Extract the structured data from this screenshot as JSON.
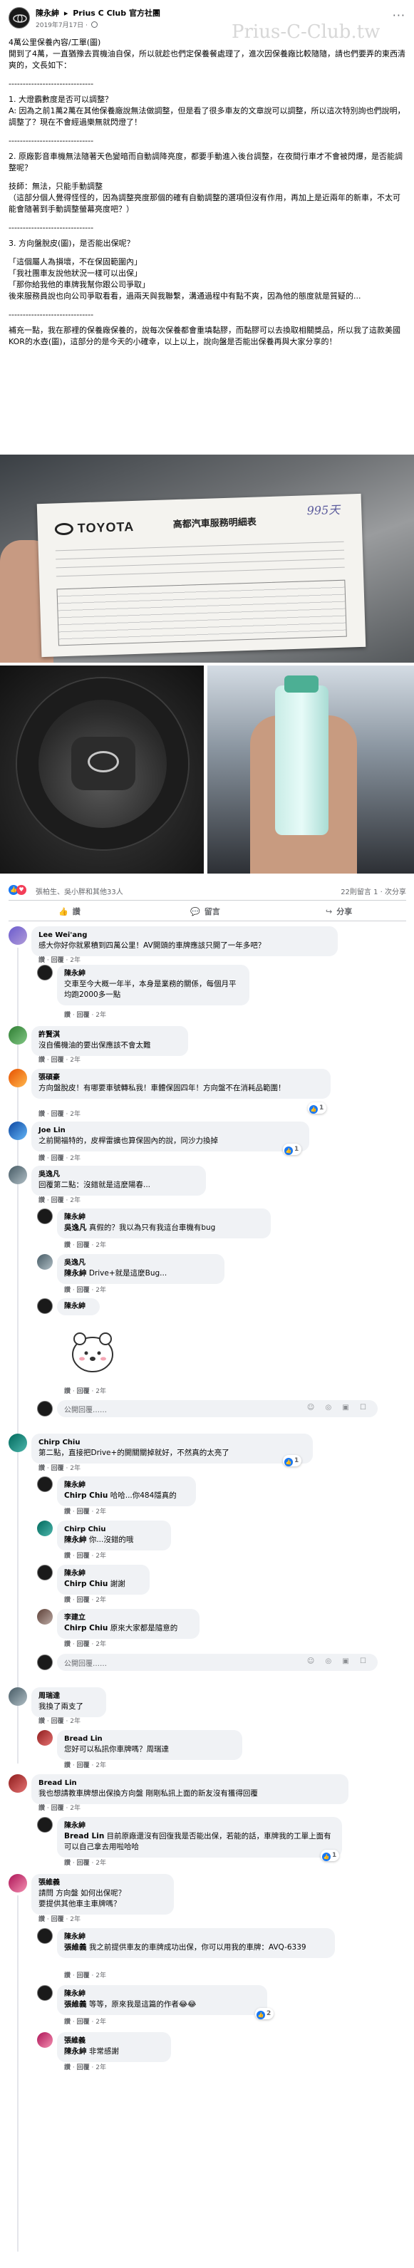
{
  "post": {
    "author": "陳永紳",
    "group": "Prius C Club 官方社團",
    "date": "2019年7月17日 ·",
    "more": "···",
    "watermark": "Prius-C-Club.tw",
    "body": [
      "4萬公里保養內容/工單(圖)",
      "開到了4萬，一直猶豫去買機油自保，所以就趁也們定保養餐處理了，進次因保養廠比較隨隨，請也們要弄的東西清爽的，文長如下：",
      "------------------------------",
      "1. 大燈霸數度是否可以調整？",
      "A: 因為之前1萬2萬在其他保養廠說無法做調整，但是看了很多車友的文章說可以調整，所以這次特別詢也們說明，調整了？現在不會經過樂無就閃燈了！",
      "------------------------------",
      "2. 原廠影音車機無法隨著天色變暗而自動調降亮度，都要手動進入後台調整，在夜間行車才不會被閃爆，是否能調整呢？",
      "技師：無法，只能手動調整",
      "（這部分個人覺得怪怪的，因為調整亮度那個的確有自動調整的選項但沒有作用，再加上是近兩年的新車，不太可能會隨著到手動調整螢幕亮度吧？）",
      "------------------------------",
      "3. 方向盤脫皮(圖)，是否能出保呢？",
      "「這個屬人為損壞，不在保固範圍內」",
      "「我社團車友說他狀況一樣可以出保」",
      "「那你給我他的車牌我幫你跟公司爭取」",
      "後來服務員說也向公司爭取看看，過兩天與我聯繫，溝通過程中有點不爽，因為他的態度就是質疑的...",
      "------------------------------",
      "補充一點，我在那裡的保養廠保養的，說每次保養都會重填黏膠，而黏膠可以去換取相關獎品，所以我了這款美國KOR的水壺(圖)，這部分的是今天的小確幸，以上以上，說向盤是否能出保養再與大家分享的！"
    ]
  },
  "photo_receipt": {
    "brand": "TOYOTA",
    "title": "高都汽車服務明細表",
    "handwriting": "995天"
  },
  "reactions": {
    "text": "張柏生、吳小胖和其他33人",
    "stats": "22則留言 1 · 次分享"
  },
  "actions": {
    "like": "讚",
    "comment": "留言",
    "share": "分享"
  },
  "comment_meta": {
    "like": "讚",
    "reply": "回覆",
    "age": "2年"
  },
  "comments": [
    {
      "name": "Lee Wei'ang",
      "text": "感大你好你就累積到四萬公里！AV開頭的車牌應該只開了一年多吧？"
    },
    {
      "name": "陳永紳",
      "text": "交車至今大概一年半，本身是業務的關係，每個月平均跑2000多一點"
    },
    {
      "name": "許賢淇",
      "text": "沒自備機油的要出保應該不會太難"
    },
    {
      "name": "張碩豪",
      "text": "方向盤脫皮！有哪要車號轉私我！車體保固四年！方向盤不在消耗品範圍！",
      "react": "1"
    },
    {
      "name": "Joe Lin",
      "text": "之前開福特的，皮桿雷擴也算保固內的說，同沙力換掉",
      "react": "1"
    },
    {
      "name": "吳逸凡",
      "text": "回覆第二點：沒錯就是這麼陽春..."
    },
    {
      "name": "陳永紳",
      "tag": "吳逸凡",
      "text": " 真假的？我以為只有我這台車機有bug"
    },
    {
      "name": "吳逸凡",
      "tag": "陳永紳",
      "text": " Drive+就是這麼Bug..."
    },
    {
      "name": "陳永紳",
      "text": ""
    },
    {
      "name": "Chirp Chiu",
      "text": "第二點，直接把Drive+的開關關掉就好，不然真的太亮了",
      "react": "1"
    },
    {
      "name": "陳永紳",
      "tag": "Chirp Chiu",
      "text": " 哈哈...你484隱真的"
    },
    {
      "name": "Chirp Chiu",
      "tag": "陳永紳",
      "text": " 你...沒錯的哦"
    },
    {
      "name": "陳永紳",
      "tag": "Chirp Chiu",
      "text": " 謝謝"
    },
    {
      "name": "李建立",
      "tag": "Chirp Chiu",
      "text": " 原來大家都是隨意的"
    },
    {
      "name": "周瑞達",
      "text": "我換了兩支了"
    },
    {
      "name": "Bread Lin",
      "tag": "",
      "text": "您好可以私訊你車牌嗎？周瑞達"
    },
    {
      "name": "Bread Lin",
      "text": "我也想請教車牌想出保換方向盤 剛剛私訊上面的新友沒有獲得回覆"
    },
    {
      "name": "陳永紳",
      "tag": "Bread Lin",
      "text": " 目前原廠還沒有回復我是否能出保，若能的話，車牌我的工單上面有可以自己拿去用啦哈哈",
      "react": "1"
    },
    {
      "name": "張維義",
      "text": "請問 方向盤 如何出保呢？\n要提供其他車主車牌嗎？"
    },
    {
      "name": "陳永紳",
      "tag": "張維義",
      "text": " 我之前提供車友的車牌成功出保，你可以用我的車牌：AVQ-6339"
    },
    {
      "name": "陳永紳",
      "tag": "張維義",
      "text": " 等等，原來我是這篇的作者😂😂",
      "react": "2"
    },
    {
      "name": "張維義",
      "tag": "陳永紳",
      "text": " 非常感謝"
    }
  ],
  "reply_placeholder": "公開回覆……",
  "icons": [
    "more-icon",
    "globe-icon",
    "like-icon",
    "comment-icon",
    "share-icon",
    "sticker-icon"
  ],
  "colors": {
    "accent": "#1877f2",
    "bubble": "#f0f2f5",
    "meta": "#65676b"
  }
}
